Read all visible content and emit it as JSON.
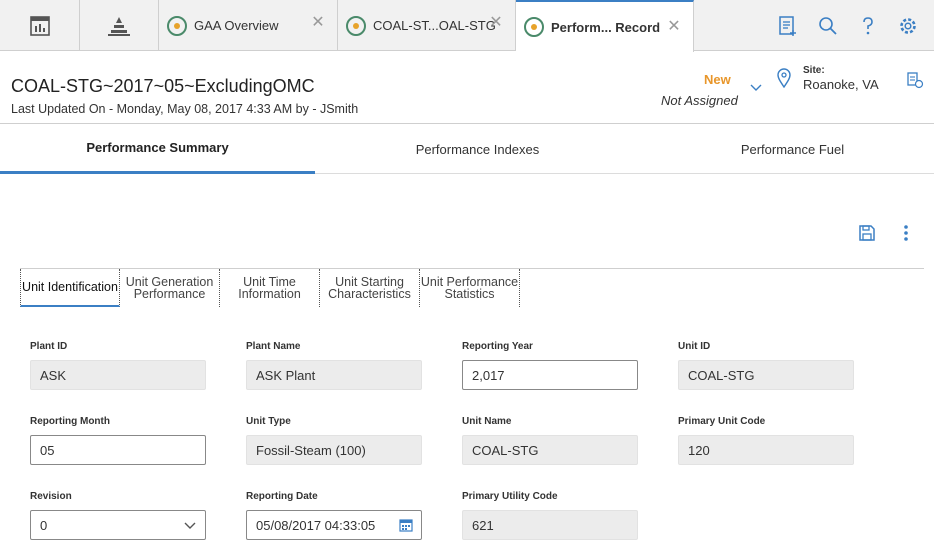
{
  "topbar": {
    "tabs": [
      {
        "icon": "dashboard-icon"
      },
      {
        "icon": "asset-hierarchy-icon"
      },
      {
        "label": "GAA Overview",
        "closable": true
      },
      {
        "label": "COAL-ST...OAL-STG",
        "closable": true
      },
      {
        "label": "Perform... Record",
        "closable": true,
        "active": true
      }
    ],
    "tools": [
      "new-record-icon",
      "search-icon",
      "help-icon",
      "settings-icon"
    ]
  },
  "record": {
    "title": "COAL-STG~2017~05~ExcludingOMC",
    "subtitle": "Last Updated On - Monday, May 08, 2017 4:33 AM by - JSmith",
    "state": "New",
    "assignment": "Not Assigned",
    "site_label": "Site:",
    "site_value": "Roanoke, VA"
  },
  "section_tabs": [
    {
      "label": "Performance Summary",
      "active": true
    },
    {
      "label": "Performance Indexes",
      "active": false
    },
    {
      "label": "Performance Fuel",
      "active": false
    }
  ],
  "subtabs": [
    {
      "label": "Unit Identification",
      "active": true
    },
    {
      "label": "Unit Generation Performance",
      "active": false
    },
    {
      "label": "Unit Time Information",
      "active": false
    },
    {
      "label": "Unit Starting Characteristics",
      "active": false
    },
    {
      "label": "Unit Performance Statistics",
      "active": false
    }
  ],
  "form": {
    "plant_id": {
      "label": "Plant ID",
      "value": "ASK"
    },
    "plant_name": {
      "label": "Plant Name",
      "value": "ASK Plant"
    },
    "reporting_year": {
      "label": "Reporting Year",
      "value": "2,017"
    },
    "unit_id": {
      "label": "Unit ID",
      "value": "COAL-STG"
    },
    "reporting_month": {
      "label": "Reporting Month",
      "value": "05"
    },
    "unit_type": {
      "label": "Unit Type",
      "value": "Fossil-Steam (100)"
    },
    "unit_name": {
      "label": "Unit Name",
      "value": "COAL-STG"
    },
    "primary_unit_code": {
      "label": "Primary Unit Code",
      "value": "120"
    },
    "revision": {
      "label": "Revision",
      "value": "0"
    },
    "reporting_date": {
      "label": "Reporting Date",
      "value": "05/08/2017 04:33:05"
    },
    "primary_utility_code": {
      "label": "Primary Utility Code",
      "value": "621"
    }
  },
  "colors": {
    "accent": "#3b7fc4",
    "state_new": "#e8962a",
    "readonly_field": "#ececec"
  }
}
